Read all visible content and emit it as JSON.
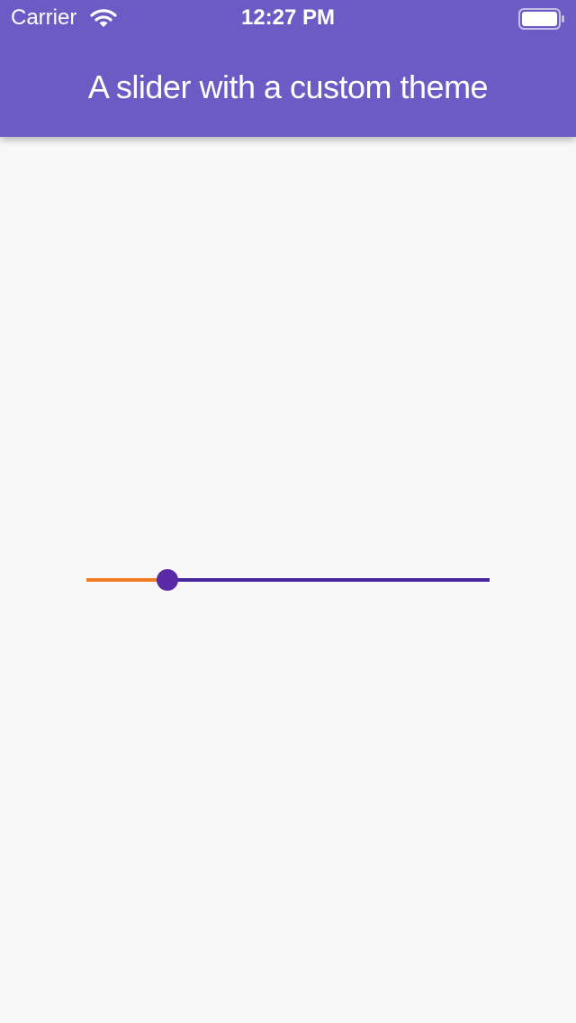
{
  "status_bar": {
    "carrier": "Carrier",
    "time": "12:27 PM",
    "wifi_icon": "wifi-icon",
    "battery_icon": "battery-full-icon"
  },
  "app_bar": {
    "title": "A slider with a custom theme",
    "background_color": "#6c5bc4"
  },
  "slider": {
    "value_fraction": 0.2,
    "active_track_color": "#f07b22",
    "inactive_track_color": "#4527a0",
    "thumb_color": "#5a2aa6"
  }
}
